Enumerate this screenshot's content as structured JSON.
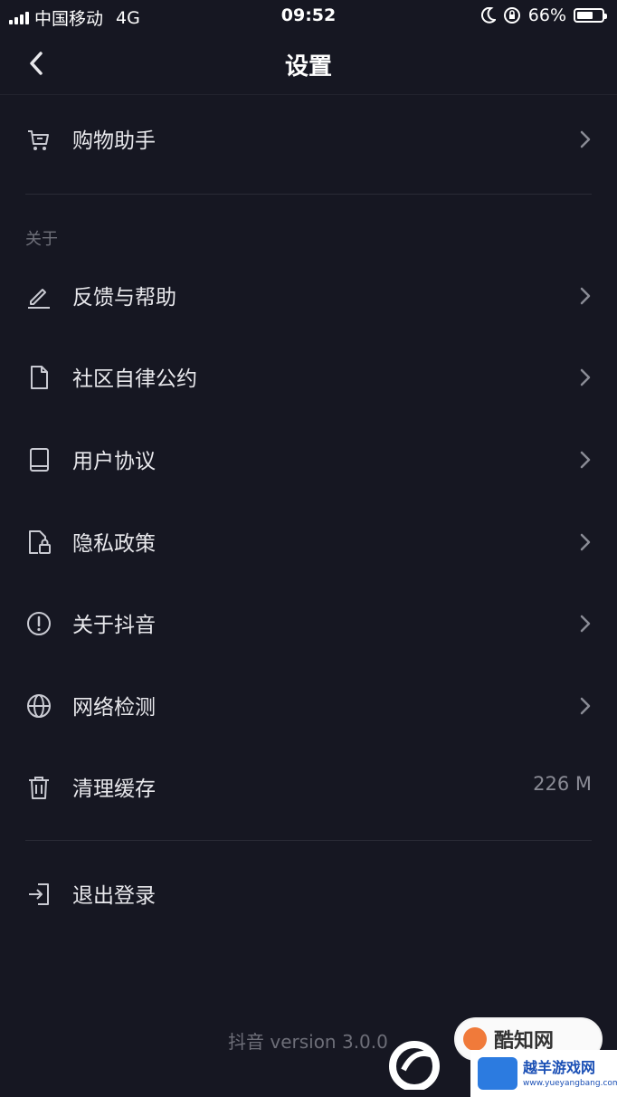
{
  "status_bar": {
    "carrier": "中国移动",
    "network": "4G",
    "time": "09:52",
    "battery_percent": "66%",
    "battery_level": 0.66
  },
  "nav": {
    "title": "设置"
  },
  "top_items": [
    {
      "label": "购物助手",
      "icon": "cart-icon"
    }
  ],
  "about_section": {
    "header": "关于",
    "items": [
      {
        "label": "反馈与帮助",
        "icon": "edit-icon"
      },
      {
        "label": "社区自律公约",
        "icon": "document-icon"
      },
      {
        "label": "用户协议",
        "icon": "book-icon"
      },
      {
        "label": "隐私政策",
        "icon": "privacy-lock-icon"
      },
      {
        "label": "关于抖音",
        "icon": "info-icon"
      },
      {
        "label": "网络检测",
        "icon": "globe-icon"
      },
      {
        "label": "清理缓存",
        "icon": "trash-icon",
        "value": "226 M"
      }
    ]
  },
  "logout": {
    "label": "退出登录",
    "icon": "logout-icon"
  },
  "footer": {
    "version": "抖音 version 3.0.0"
  },
  "watermarks": {
    "kuzhi_text": "酷知网",
    "yueyang_text": "越羊游戏网",
    "yueyang_url": "www.yueyangbang.com"
  },
  "colors": {
    "background": "#161722",
    "text": "#e8e8ec",
    "muted": "#6f707a"
  }
}
